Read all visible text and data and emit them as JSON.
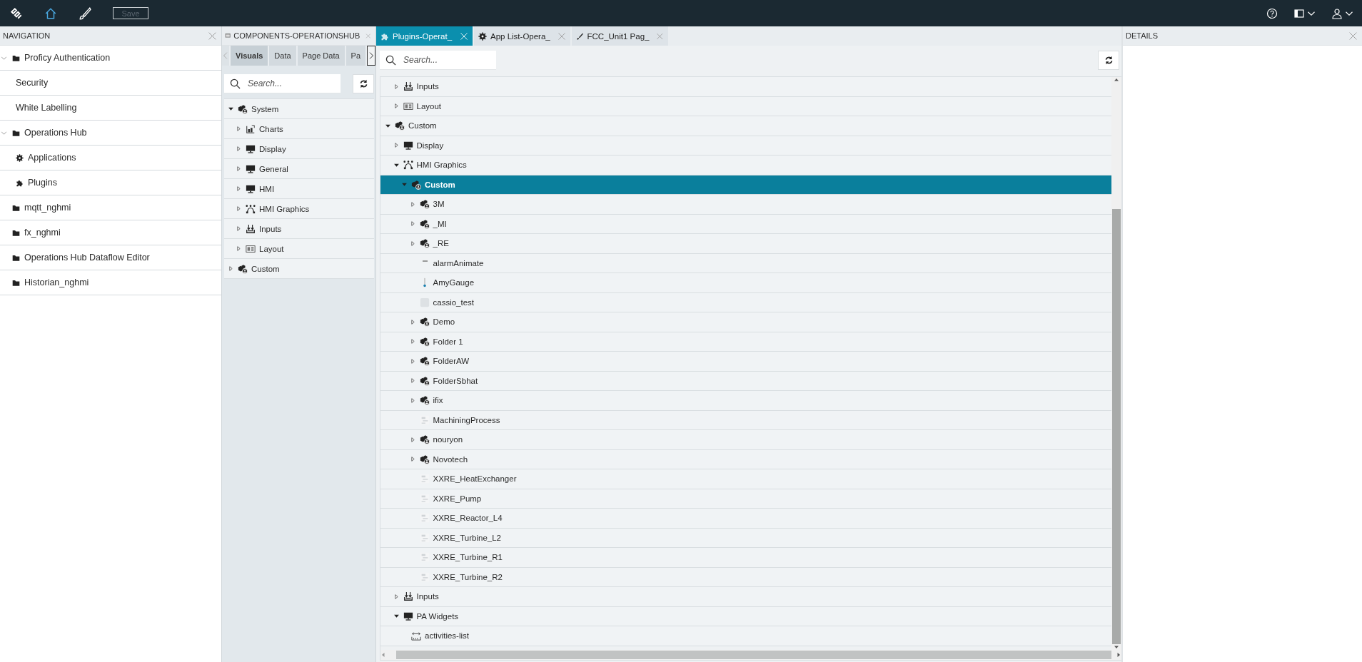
{
  "top_bar": {
    "tools": [
      {
        "kind": "logo",
        "selected": false
      },
      {
        "kind": "home",
        "selected": true
      },
      {
        "kind": "designer",
        "selected": false
      }
    ],
    "save_button": {
      "label": "Save",
      "disabled": true
    },
    "right_tools": [
      {
        "kind": "help"
      },
      {
        "kind": "panels"
      },
      {
        "kind": "user"
      }
    ]
  },
  "navigation": {
    "title": "NAVIGATION",
    "items": [
      {
        "label": "Proficy Authentication",
        "kind": "folder",
        "expanded": true,
        "children": [
          {
            "label": "Security",
            "kind": "page"
          },
          {
            "label": "White Labelling",
            "kind": "page"
          }
        ]
      },
      {
        "label": "Operations Hub",
        "kind": "folder",
        "expanded": true,
        "children": [
          {
            "label": "Applications",
            "kind": "app"
          },
          {
            "label": "Plugins",
            "kind": "plugin"
          }
        ]
      },
      {
        "label": "mqtt_nghmi",
        "kind": "folder"
      },
      {
        "label": "fx_nghmi",
        "kind": "folder"
      },
      {
        "label": "Operations Hub Dataflow Editor",
        "kind": "folder"
      },
      {
        "label": "Historian_nghmi",
        "kind": "folder"
      }
    ]
  },
  "components_panel": {
    "title": "COMPONENTS-OPERATIONSHUB",
    "tabs": [
      {
        "label": "Visuals",
        "selected": true
      },
      {
        "label": "Data",
        "selected": false
      },
      {
        "label": "Page Data",
        "selected": false
      },
      {
        "label": "Pa",
        "selected": false
      }
    ],
    "search": {
      "placeholder": "Search..."
    },
    "tree": [
      {
        "label": "System",
        "kind": "group",
        "expanded": true,
        "children": [
          {
            "label": "Charts",
            "kind": "chart",
            "expanded": false
          },
          {
            "label": "Display",
            "kind": "display",
            "expanded": false
          },
          {
            "label": "General",
            "kind": "display",
            "expanded": false
          },
          {
            "label": "HMI",
            "kind": "display",
            "expanded": false
          },
          {
            "label": "HMI Graphics",
            "kind": "graphics",
            "expanded": false
          },
          {
            "label": "Inputs",
            "kind": "inputs",
            "expanded": false
          },
          {
            "label": "Layout",
            "kind": "layout",
            "expanded": false
          }
        ]
      },
      {
        "label": "Custom",
        "kind": "group",
        "expanded": false
      }
    ]
  },
  "document_tabs": [
    {
      "label": "Plugins-Operat_",
      "kind": "plugin",
      "selected": true
    },
    {
      "label": "App List-Opera_",
      "kind": "app",
      "selected": false
    },
    {
      "label": "FCC_Unit1 Pag_",
      "kind": "page",
      "selected": false
    }
  ],
  "plugin_editor": {
    "search": {
      "placeholder": "Search..."
    },
    "tree": {
      "continued": [
        {
          "label": "Inputs",
          "kind": "inputs",
          "expanded": false,
          "selected": false
        },
        {
          "label": "Layout",
          "kind": "layout",
          "expanded": false,
          "selected": false
        }
      ],
      "items": [
        {
          "label": "Custom",
          "kind": "group",
          "expanded": true,
          "selected": false,
          "children": [
            {
              "label": "Display",
              "kind": "display",
              "expanded": false,
              "selected": false
            },
            {
              "label": "HMI Graphics",
              "kind": "graphics",
              "expanded": true,
              "selected": false,
              "children": [
                {
                  "label": "Custom",
                  "kind": "group",
                  "expanded": true,
                  "selected": true,
                  "children": [
                    {
                      "label": "3M",
                      "kind": "group",
                      "expanded": false,
                      "selected": false
                    },
                    {
                      "label": "_MI",
                      "kind": "group",
                      "expanded": false,
                      "selected": false
                    },
                    {
                      "label": "_RE",
                      "kind": "group",
                      "expanded": false,
                      "selected": false
                    },
                    {
                      "label": "alarmAnimate",
                      "kind": "dash",
                      "selected": false
                    },
                    {
                      "label": "AmyGauge",
                      "kind": "gauge",
                      "selected": false
                    },
                    {
                      "label": "cassio_test",
                      "kind": "thumbnail",
                      "selected": false
                    },
                    {
                      "label": "Demo",
                      "kind": "group",
                      "expanded": false,
                      "selected": false
                    },
                    {
                      "label": "Folder 1",
                      "kind": "group",
                      "expanded": false,
                      "selected": false
                    },
                    {
                      "label": "FolderAW",
                      "kind": "group",
                      "expanded": false,
                      "selected": false
                    },
                    {
                      "label": "FolderSbhat",
                      "kind": "group",
                      "expanded": false,
                      "selected": false
                    },
                    {
                      "label": "ifix",
                      "kind": "group",
                      "expanded": false,
                      "selected": false
                    },
                    {
                      "label": "MachiningProcess",
                      "kind": "diagram",
                      "selected": false
                    },
                    {
                      "label": "nouryon",
                      "kind": "group",
                      "expanded": false,
                      "selected": false
                    },
                    {
                      "label": "Novotech",
                      "kind": "group",
                      "expanded": false,
                      "selected": false
                    },
                    {
                      "label": "XXRE_HeatExchanger",
                      "kind": "diagram",
                      "selected": false
                    },
                    {
                      "label": "XXRE_Pump",
                      "kind": "diagram",
                      "selected": false
                    },
                    {
                      "label": "XXRE_Reactor_L4",
                      "kind": "diagram",
                      "selected": false
                    },
                    {
                      "label": "XXRE_Turbine_L2",
                      "kind": "diagram",
                      "selected": false
                    },
                    {
                      "label": "XXRE_Turbine_R1",
                      "kind": "diagram",
                      "selected": false
                    },
                    {
                      "label": "XXRE_Turbine_R2",
                      "kind": "diagram",
                      "selected": false
                    }
                  ]
                }
              ]
            },
            {
              "label": "Inputs",
              "kind": "inputs",
              "expanded": false,
              "selected": false
            },
            {
              "label": "PA Widgets",
              "kind": "display",
              "expanded": true,
              "selected": false,
              "children": [
                {
                  "label": "activities-list",
                  "kind": "list-widget",
                  "selected": false
                }
              ]
            }
          ]
        }
      ]
    }
  },
  "details": {
    "title": "DETAILS"
  }
}
